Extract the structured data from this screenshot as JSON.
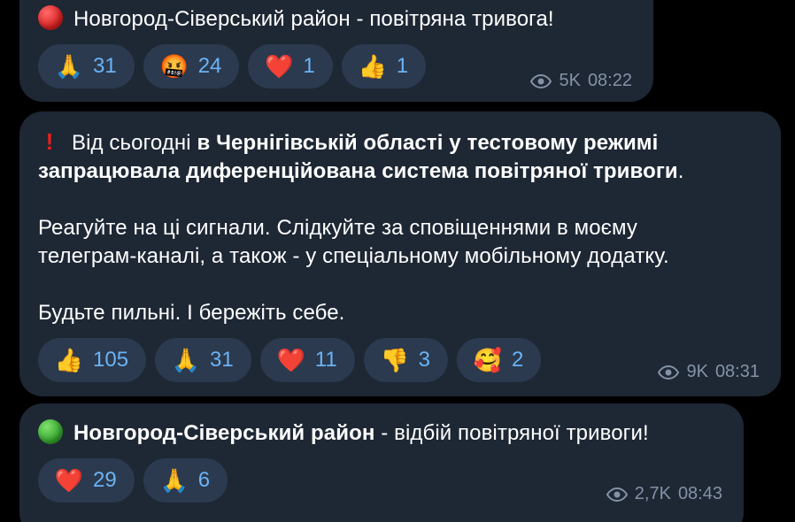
{
  "messages": [
    {
      "id": "m1",
      "icon": "red-circle",
      "text": "Новгород-Сіверський район - повітряна тривога!",
      "reactions": [
        {
          "emoji": "🙏",
          "icon": "folded-hands",
          "count": "31"
        },
        {
          "emoji": "🤬",
          "icon": "cursing-face",
          "count": "24"
        },
        {
          "emoji": "❤️",
          "icon": "red-heart",
          "count": "1"
        },
        {
          "emoji": "👍",
          "icon": "thumbs-up",
          "count": "1"
        }
      ],
      "views": "5K",
      "time": "08:22"
    },
    {
      "id": "m2",
      "icon": "exclamation-mark",
      "text_part1": "Від сьогодні ",
      "text_bold": "в Чернігівській області у тестовому режимі запрацювала диференційована система повітряної тривоги",
      "text_part2": ".",
      "line1_plain": "Від сьогодні ",
      "line1_bold": "в Чернігівській області у тестовому режимі",
      "line2_bold": "запрацювала диференційована система повітряної тривоги",
      "line2_plain": ".",
      "para2_line1": "Реагуйте на ці сигнали. Слідкуйте за сповіщеннями в моєму",
      "para2_line2": "телеграм-каналі, а також - у спеціальному мобільному додатку.",
      "para3": "Будьте пильні. І бережіть себе.",
      "reactions": [
        {
          "emoji": "👍",
          "icon": "thumbs-up",
          "count": "105"
        },
        {
          "emoji": "🙏",
          "icon": "folded-hands",
          "count": "31"
        },
        {
          "emoji": "❤️",
          "icon": "red-heart",
          "count": "11"
        },
        {
          "emoji": "👎",
          "icon": "thumbs-down",
          "count": "3"
        },
        {
          "emoji": "🥰",
          "icon": "smiling-face-with-hearts",
          "count": "2"
        }
      ],
      "views": "9K",
      "time": "08:31"
    },
    {
      "id": "m3",
      "icon": "green-circle",
      "text_bold": "Новгород-Сіверський район",
      "text_plain": " - відбій повітряної тривоги!",
      "reactions": [
        {
          "emoji": "❤️",
          "icon": "red-heart",
          "count": "29"
        },
        {
          "emoji": "🙏",
          "icon": "folded-hands",
          "count": "6"
        }
      ],
      "views": "2,7K",
      "time": "08:43"
    }
  ],
  "colors": {
    "background": "#000000",
    "bubble": "#1e2734",
    "reaction_bg": "#2b3a4f",
    "reaction_text": "#6bb3f5",
    "meta_text": "#8393a6"
  }
}
